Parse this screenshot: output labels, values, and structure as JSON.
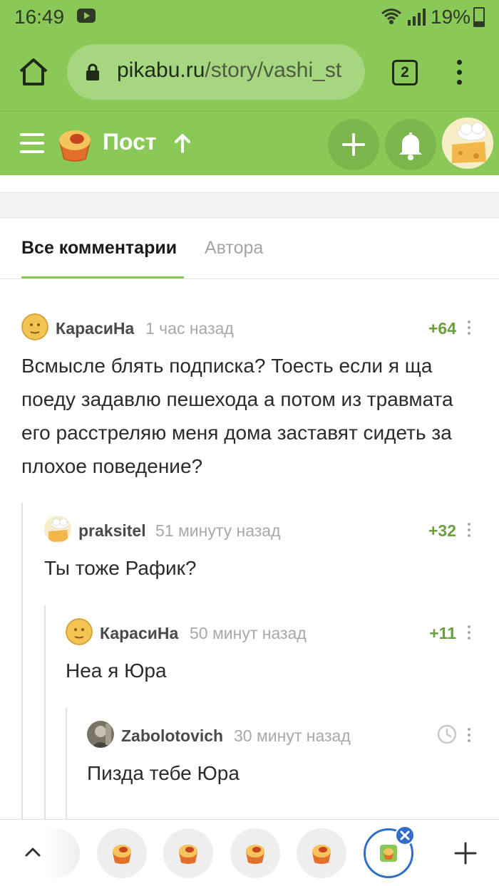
{
  "status_bar": {
    "time": "16:49",
    "battery": "19%"
  },
  "browser": {
    "url_domain": "pikabu.ru",
    "url_path": "/story/vashi_st",
    "tabs_count": "2"
  },
  "header": {
    "title": "Пост"
  },
  "tabs": {
    "all": "Все комментарии",
    "author": "Автора"
  },
  "comments": [
    {
      "user": "КарасиНа",
      "time": "1 час назад",
      "rating": "+64",
      "text": "Всмысле блять подписка? Тоесть если я ща поеду задавлю пешехода а потом из травмата его расстреляю меня дома заставят сидеть за плохое поведение?"
    },
    {
      "user": "praksitel",
      "time": "51 минуту назад",
      "rating": "+32",
      "text": "Ты тоже Рафик?"
    },
    {
      "user": "КарасиНа",
      "time": "50 минут назад",
      "rating": "+11",
      "text": "Неа я Юра"
    },
    {
      "user": "Zabolotovich",
      "time": "30 минут назад",
      "text": "Пизда тебе Юра"
    }
  ],
  "colors": {
    "brand_green": "#8ac858",
    "rating_green": "#6a9e3e"
  },
  "icons": [
    "home-icon",
    "lock-icon",
    "more-vert-icon",
    "hamburger-icon",
    "pikabu-logo",
    "arrow-up-icon",
    "plus-icon",
    "bell-icon",
    "clock-icon",
    "chevron-up-icon",
    "close-icon"
  ]
}
